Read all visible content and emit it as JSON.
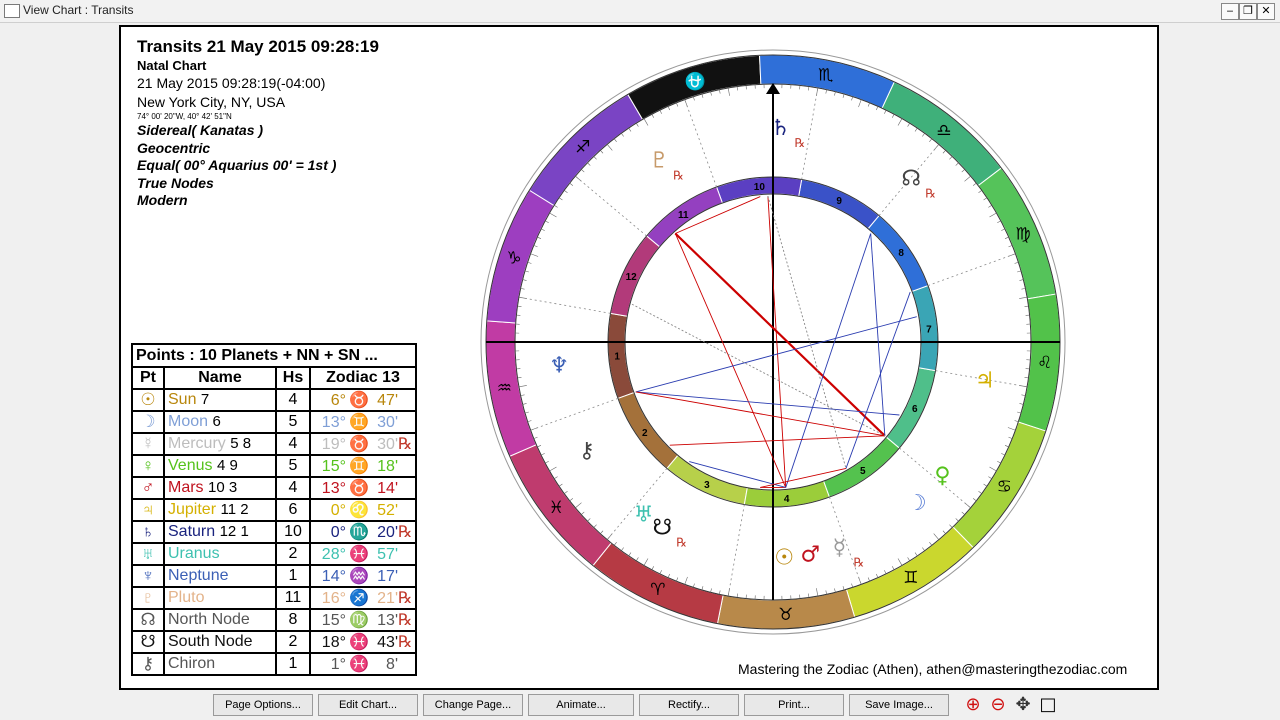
{
  "window": {
    "title": "View Chart : Transits",
    "minimize": "‒",
    "restore": "❐",
    "close": "✕"
  },
  "header": {
    "title": "Transits 21 May 2015 09:28:19",
    "chart_type": "Natal Chart",
    "datetime": "21 May 2015 09:28:19(-04:00)",
    "location": "New York City, NY, USA",
    "coords": "74° 00' 20\"W, 40° 42' 51\"N",
    "zodiac": "Sidereal( Kanatas )",
    "centric": "Geocentric",
    "houses": "Equal( 00° Aquarius 00' = 1st )",
    "nodes": "True Nodes",
    "style": "Modern"
  },
  "table": {
    "caption": "Points : 10 Planets + NN + SN ...",
    "headers": [
      "Pt",
      "Name",
      "Hs",
      "Zodiac 13"
    ],
    "rows": [
      {
        "glyph": "☉",
        "name": "Sun",
        "sub": "7",
        "hs": "4",
        "deg": "6°",
        "sign": "♉",
        "min": "47'",
        "rx": "",
        "color": "#b8860b"
      },
      {
        "glyph": "☽",
        "name": "Moon",
        "sub": "6",
        "hs": "5",
        "deg": "13°",
        "sign": "♊",
        "min": "30'",
        "rx": "",
        "color": "#7f9fd6"
      },
      {
        "glyph": "☿",
        "name": "Mercury",
        "sub": "5 8",
        "hs": "4",
        "deg": "19°",
        "sign": "♉",
        "min": "30'",
        "rx": "℞",
        "color": "#bdbdbd"
      },
      {
        "glyph": "♀",
        "name": "Venus",
        "sub": "4 9",
        "hs": "5",
        "deg": "15°",
        "sign": "♊",
        "min": "18'",
        "rx": "",
        "color": "#55c21c"
      },
      {
        "glyph": "♂",
        "name": "Mars",
        "sub": "10 3",
        "hs": "4",
        "deg": "13°",
        "sign": "♉",
        "min": "14'",
        "rx": "",
        "color": "#c0131f"
      },
      {
        "glyph": "♃",
        "name": "Jupiter",
        "sub": "11 2",
        "hs": "6",
        "deg": "0°",
        "sign": "♌",
        "min": "52'",
        "rx": "",
        "color": "#d4b000"
      },
      {
        "glyph": "♄",
        "name": "Saturn",
        "sub": "12 1",
        "hs": "10",
        "deg": "0°",
        "sign": "♏",
        "min": "20'",
        "rx": "℞",
        "color": "#1a237e"
      },
      {
        "glyph": "♅",
        "name": "Uranus",
        "sub": "",
        "hs": "2",
        "deg": "28°",
        "sign": "♓",
        "min": "57'",
        "rx": "",
        "color": "#3ec1b0"
      },
      {
        "glyph": "♆",
        "name": "Neptune",
        "sub": "",
        "hs": "1",
        "deg": "14°",
        "sign": "♒",
        "min": "17'",
        "rx": "",
        "color": "#3b5fb5"
      },
      {
        "glyph": "♇",
        "name": "Pluto",
        "sub": "",
        "hs": "11",
        "deg": "16°",
        "sign": "♐",
        "min": "21'",
        "rx": "℞",
        "color": "#e3b38a"
      },
      {
        "glyph": "☊",
        "name": "North Node",
        "sub": "",
        "hs": "8",
        "deg": "15°",
        "sign": "♍",
        "min": "13'",
        "rx": "℞",
        "color": "#555555"
      },
      {
        "glyph": "☋",
        "name": "South Node",
        "sub": "",
        "hs": "2",
        "deg": "18°",
        "sign": "♓",
        "min": "43'",
        "rx": "℞",
        "color": "#111111"
      },
      {
        "glyph": "⚷",
        "name": "Chiron",
        "sub": "",
        "hs": "1",
        "deg": "1°",
        "sign": "♓",
        "min": "8'",
        "rx": "",
        "color": "#555555"
      }
    ]
  },
  "wheel": {
    "signs": [
      {
        "glyph": "♎",
        "color": "#3fb07a"
      },
      {
        "glyph": "♍",
        "color": "#55c35a"
      },
      {
        "glyph": "♌",
        "color": "#52c24a"
      },
      {
        "glyph": "♋",
        "color": "#a4d23a"
      },
      {
        "glyph": "♊",
        "color": "#cad72e"
      },
      {
        "glyph": "♉",
        "color": "#b8894a"
      },
      {
        "glyph": "♈",
        "color": "#b63a44"
      },
      {
        "glyph": "♓",
        "color": "#bf3b6e"
      },
      {
        "glyph": "♒",
        "color": "#c13ba4"
      },
      {
        "glyph": "♑",
        "color": "#9d3ec0"
      },
      {
        "glyph": "♐",
        "color": "#7a44c4"
      },
      {
        "glyph": "⛎",
        "color": "#111111"
      },
      {
        "glyph": "♏",
        "color": "#2f6fd8"
      }
    ],
    "houses": [
      "1",
      "2",
      "3",
      "4",
      "5",
      "6",
      "7",
      "8",
      "9",
      "10",
      "11",
      "12"
    ],
    "house_colors": [
      "#8a4a3a",
      "#a4713a",
      "#b7d04a",
      "#9bcd3a",
      "#54c24e",
      "#4fbf8a",
      "#3aa5b5",
      "#2f6fd8",
      "#3a52c8",
      "#5b3fc2",
      "#9440c0",
      "#b23a7a"
    ],
    "retro_mark": "℞",
    "planets": [
      {
        "glyph": "♄",
        "color": "#1a237e",
        "rx": true
      },
      {
        "glyph": "♇",
        "color": "#c79a6a",
        "rx": true
      },
      {
        "glyph": "☊",
        "color": "#444444",
        "rx": true
      },
      {
        "glyph": "♃",
        "color": "#d4b000",
        "rx": false
      },
      {
        "glyph": "♀",
        "color": "#55c21c",
        "rx": false
      },
      {
        "glyph": "☽",
        "color": "#5b7fd6",
        "rx": false
      },
      {
        "glyph": "☿",
        "color": "#9a9a9a",
        "rx": true
      },
      {
        "glyph": "♂",
        "color": "#c0131f",
        "rx": false
      },
      {
        "glyph": "☉",
        "color": "#b8860b",
        "rx": false
      },
      {
        "glyph": "☋",
        "color": "#111111",
        "rx": true
      },
      {
        "glyph": "♅",
        "color": "#3ec1b0",
        "rx": false
      },
      {
        "glyph": "⚷",
        "color": "#444444",
        "rx": false
      },
      {
        "glyph": "♆",
        "color": "#3b5fb5",
        "rx": false
      }
    ]
  },
  "footer": "Mastering the Zodiac (Athen), athen@masteringthezodiac.com",
  "buttons": [
    "Page Options...",
    "Edit Chart...",
    "Change Page...",
    "Animate...",
    "Rectify...",
    "Print...",
    "Save Image..."
  ],
  "tools": {
    "zoom_in": "⊕",
    "zoom_out": "⊖",
    "pan": "✥",
    "fit": "□"
  }
}
